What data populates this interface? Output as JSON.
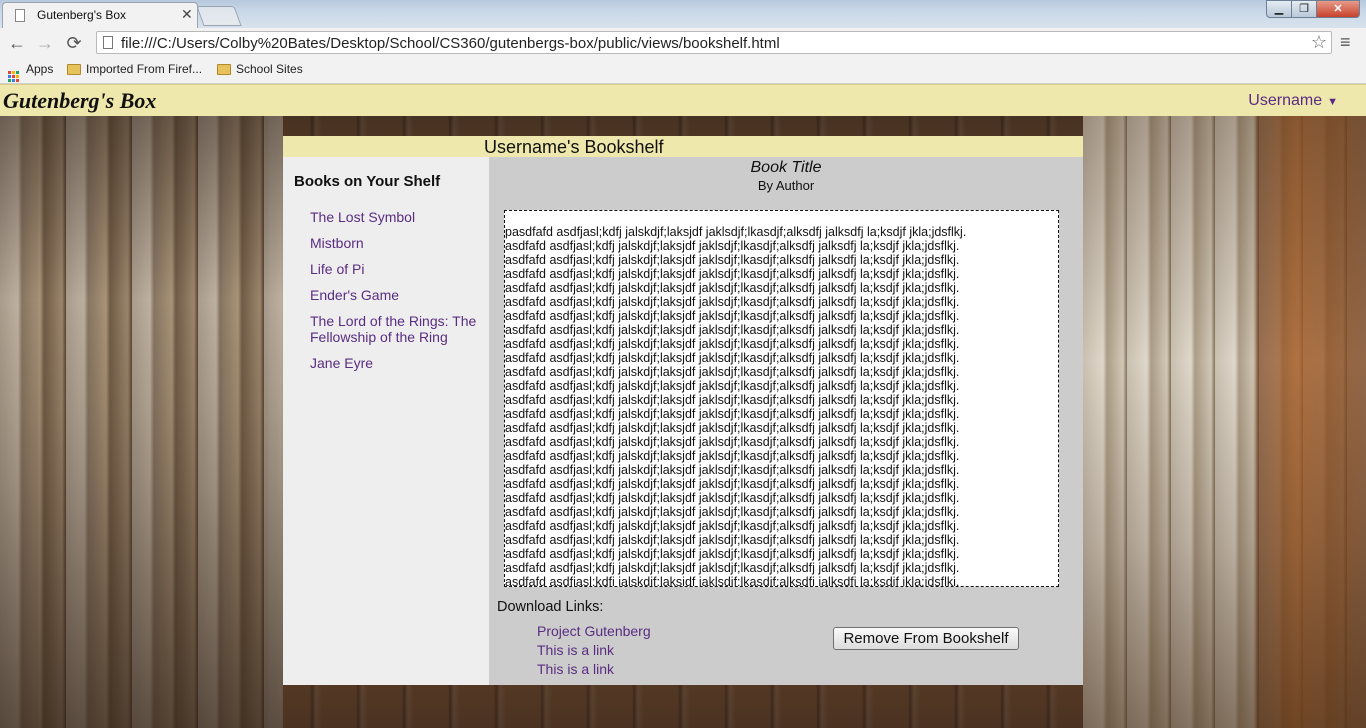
{
  "browser": {
    "tab_title": "Gutenberg's Box",
    "tab_close": "✕",
    "url": "file:///C:/Users/Colby%20Bates/Desktop/School/CS360/gutenbergs-box/public/views/bookshelf.html",
    "nav": {
      "back": "←",
      "forward": "→",
      "reload": "⟳"
    },
    "star": "☆",
    "menu": "≡",
    "window_buttons": {
      "minimize": "▁",
      "maximize": "❐",
      "close": "✕"
    },
    "bookmarks": [
      {
        "label": "Apps",
        "icon": "apps-grid-icon"
      },
      {
        "label": "Imported From Firef...",
        "icon": "folder-icon"
      },
      {
        "label": "School Sites",
        "icon": "folder-icon"
      }
    ]
  },
  "site": {
    "logo": "Gutenberg's Box",
    "user_menu": "Username",
    "user_caret": "▼"
  },
  "bookshelf": {
    "title": "Username's Bookshelf",
    "sidebar_heading": "Books on Your Shelf",
    "books": [
      "The Lost Symbol",
      "Mistborn",
      "Life of Pi",
      "Ender's Game",
      "The Lord of the Rings: The Fellowship of the Ring",
      "Jane Eyre"
    ],
    "book_title": "Book Title",
    "book_author": "By Author",
    "reader_first_line": "pasdfafd asdfjasl;kdfj jalskdjf;laksjdf jaklsdjf;lkasdjf;alksdfj jalksdfj la;ksdjf jkla;jdsflkj.",
    "reader_repeat_line": "asdfafd asdfjasl;kdfj jalskdjf;laksjdf jaklsdjf;lkasdjf;alksdfj jalksdfj la;ksdjf jkla;jdsflkj.",
    "download_heading": "Download Links:",
    "download_links": [
      "Project Gutenberg",
      "This is a link",
      "This is a link"
    ],
    "remove_button": "Remove From Bookshelf"
  },
  "colors": {
    "header_bg": "#efe8ad",
    "link": "#5a2d82",
    "panel_bg": "#cccccc",
    "sidebar_bg": "#eeeeee"
  }
}
